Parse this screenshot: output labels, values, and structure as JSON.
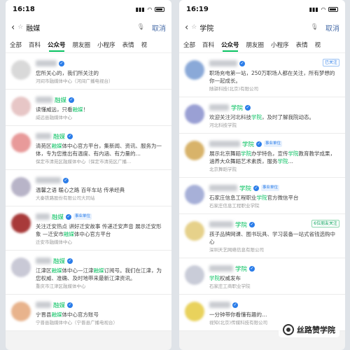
{
  "left": {
    "status": {
      "time": "16:18"
    },
    "search": {
      "query": "融媒",
      "cancel": "取消"
    },
    "tabs": [
      "全部",
      "百科",
      "公众号",
      "朋友圈",
      "小程序",
      "表情",
      "视"
    ],
    "active_tab": 2,
    "items": [
      {
        "name": "",
        "badge": "",
        "tag": "",
        "desc": "您所关心的，我们所关注的",
        "sub": "河间市融媒体中心（河间广播电视台）",
        "avatar": "#d9d9d9",
        "nw": 30
      },
      {
        "name": "融媒",
        "badge": "",
        "tag": "",
        "desc": "读懂威远，只看融媒！",
        "sub": "威远县融媒体中心",
        "avatar": "#e7c6c6",
        "nw": 24
      },
      {
        "name": "融媒",
        "badge": "",
        "tag": "",
        "desc": "清苑区融媒体中心官方平台，集新闻、资讯、服务为一体，专为您推出有温度、有内涵、有力量的…",
        "sub": "保定市清苑区融媒体中心（保定市清苑区广播…",
        "avatar": "#e89a9a",
        "nw": 22
      },
      {
        "name": "",
        "badge": "",
        "tag": "",
        "desc": "温馨之语 暖心之路 百年车站 传承经典",
        "sub": "大秦铁路股份有限公司大同站",
        "avatar": "#b8b4c8",
        "nw": 36
      },
      {
        "name": "融媒",
        "badge": "事业单位",
        "tag": "",
        "desc": "关注迁安热点 讲好迁安故事 传递迁安声音 展示迁安形象 —迁安市融媒体中心官方平台",
        "sub": "迁安市融媒体中心",
        "avatar": "#a83a3a",
        "nw": 20
      },
      {
        "name": "融媒",
        "badge": "",
        "tag": "",
        "desc": "江津区融媒体中心—江津融媒订阅号。我们在江津，为您权威、准确、及时地带来最新江津资讯。",
        "sub": "重庆市江津区融媒体中心",
        "avatar": "#c9c9d6",
        "nw": 22
      },
      {
        "name": "融媒",
        "badge": "",
        "tag": "",
        "desc": "宁晋县融媒体中心官方账号",
        "sub": "宁晋县融媒体中心（宁晋县广播电视台）",
        "avatar": "#e8b38c",
        "nw": 22
      }
    ]
  },
  "right": {
    "status": {
      "time": "16:19"
    },
    "search": {
      "query": "学院",
      "cancel": "取消"
    },
    "tabs": [
      "全部",
      "百科",
      "公众号",
      "朋友圈",
      "小程序",
      "表情",
      "视"
    ],
    "active_tab": 2,
    "items": [
      {
        "name": "",
        "badge": "",
        "tag": "已关注",
        "desc": "职场充电第一站，250万职场人都在关注，所有梦想的你一起成长。",
        "sub": "随驿科技(北京)有限公司",
        "avatar": "#8aa9d8",
        "nw": 40
      },
      {
        "name": "学院",
        "badge": "",
        "tag": "",
        "desc": "欢迎关注河北科技学院，及时了解我院动态。",
        "sub": "河北科技学院",
        "avatar": "#9aa0d4",
        "nw": 28
      },
      {
        "name": "学院",
        "badge": "事业单位",
        "tag": "",
        "desc": "展示北京舞蹈学院办学特色，宣传学院教育教学成果，涵养大众舞蹈艺术素质，服务学院…",
        "sub": "北京舞蹈学院",
        "avatar": "#d8b36a",
        "nw": 44
      },
      {
        "name": "学院",
        "badge": "事业单位",
        "tag": "",
        "desc": "石家庄信息工程职业学院官方微信平台",
        "sub": "石家庄信息工程职业学院",
        "avatar": "#a7b0d8",
        "nw": 40
      },
      {
        "name": "学院",
        "badge": "",
        "tag": "6位朋友关注",
        "desc": "孩子品牌网课、图书玩具、学习装备一站式省钱选购中心",
        "sub": "深圳天艺网络信息有限公司",
        "avatar": "#e6d18a",
        "nw": 34
      },
      {
        "name": "学院",
        "badge": "",
        "tag": "",
        "desc": "学院权威发布",
        "sub": "石家庄工商职业学院",
        "avatar": "#c9ccd8",
        "nw": 34
      },
      {
        "name": "",
        "badge": "",
        "tag": "",
        "desc": "一分钟带你看懂有趣的…",
        "sub": "视知(北京)传媒科技有限公司",
        "avatar": "#e9d25c",
        "nw": 30
      }
    ],
    "watermark": "丝路赞学院"
  }
}
